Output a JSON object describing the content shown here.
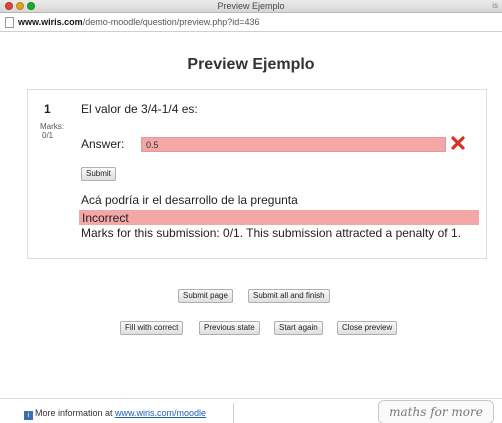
{
  "window": {
    "title": "Preview Ejemplo",
    "corner_text": "is"
  },
  "address_bar": {
    "host": "www.wiris.com",
    "path": "/demo-moodle/question/preview.php?id=436"
  },
  "page": {
    "title": "Preview Ejemplo"
  },
  "question": {
    "number": "1",
    "marks_label": "Marks:",
    "marks_value": "0/1",
    "text": "El valor de 3/4-1/4 es:",
    "answer_label": "Answer:",
    "answer_value": "0.5",
    "submit_label": "Submit",
    "development_text": "Acá podría ir el desarrollo de la pregunta",
    "feedback_status": "Incorrect",
    "marks_message": "Marks for this submission: 0/1. This submission attracted a penalty of 1."
  },
  "actions": {
    "submit_page": "Submit page",
    "submit_all": "Submit all and finish",
    "fill_correct": "Fill with correct",
    "previous_state": "Previous state",
    "start_again": "Start again",
    "close_preview": "Close preview"
  },
  "footer": {
    "info_icon_text": "i",
    "info_text": "More information at ",
    "info_link": "www.wiris.com/moodle",
    "brand": "maths for more"
  },
  "colors": {
    "incorrect_bg": "#f4a7a7",
    "wrong_mark": "#d9301f",
    "link": "#1a5fb4"
  },
  "icons": {
    "status": "close-x-icon",
    "footer": "info-icon"
  }
}
